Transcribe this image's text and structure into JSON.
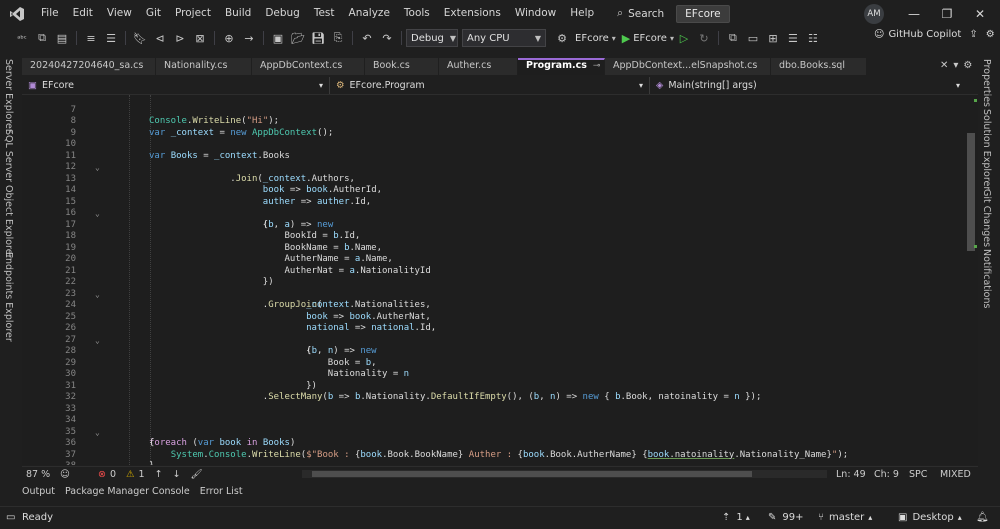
{
  "title_bar": {
    "menu": [
      "File",
      "Edit",
      "View",
      "Git",
      "Project",
      "Build",
      "Debug",
      "Test",
      "Analyze",
      "Tools",
      "Extensions",
      "Window",
      "Help"
    ],
    "search_label": "Search",
    "solution_name": "EFcore",
    "avatar_initials": "AM"
  },
  "toolbar": {
    "config": "Debug",
    "platform": "Any CPU",
    "startup_project": "EFcore",
    "run_target": "EFcore",
    "copilot": "GitHub Copilot"
  },
  "side_panels": {
    "left": [
      "Server Explorer",
      "SQL Server Object Explorer",
      "Endpoints Explorer"
    ],
    "right": [
      "Properties",
      "Solution Explorer",
      "Git Changes",
      "Notifications"
    ]
  },
  "doc_tabs": [
    {
      "label": "20240427204640_sa.cs",
      "active": false
    },
    {
      "label": "Nationality.cs",
      "active": false
    },
    {
      "label": "AppDbContext.cs",
      "active": false
    },
    {
      "label": "Book.cs",
      "active": false
    },
    {
      "label": "Auther.cs",
      "active": false
    },
    {
      "label": "Program.cs",
      "active": true
    },
    {
      "label": "AppDbContext...elSnapshot.cs",
      "active": false
    },
    {
      "label": "dbo.Books.sql",
      "active": false
    }
  ],
  "nav_bar": {
    "project": "EFcore",
    "type": "EFcore.Program",
    "member": "Main(string[] args)"
  },
  "editor": {
    "line_numbers": [
      "7",
      "8",
      "9",
      "10",
      "11",
      "12",
      "13",
      "14",
      "15",
      "16",
      "17",
      "18",
      "19",
      "20",
      "21",
      "22",
      "23",
      "24",
      "25",
      "26",
      "27",
      "28",
      "29",
      "30",
      "31",
      "32",
      "33",
      "34",
      "35",
      "36",
      "37",
      "38"
    ]
  },
  "editor_status": {
    "zoom": "87 %",
    "errors": "0",
    "warnings": "1",
    "line": "Ln: 49",
    "col": "Ch: 9",
    "spacing": "SPC",
    "line_endings": "MIXED"
  },
  "tool_tabs": [
    "Output",
    "Package Manager Console",
    "Error List"
  ],
  "status_bar": {
    "state": "Ready",
    "up_count": "1",
    "pending_changes": "99+",
    "branch": "master",
    "repo": "Desktop"
  },
  "colors": {
    "accent": "#9a6ad6",
    "keyword": "#569cd6",
    "type": "#4ec9b0",
    "identifier": "#9cdcfe",
    "method": "#dcdcaa",
    "string": "#d69d85",
    "comment": "#57a64a"
  }
}
